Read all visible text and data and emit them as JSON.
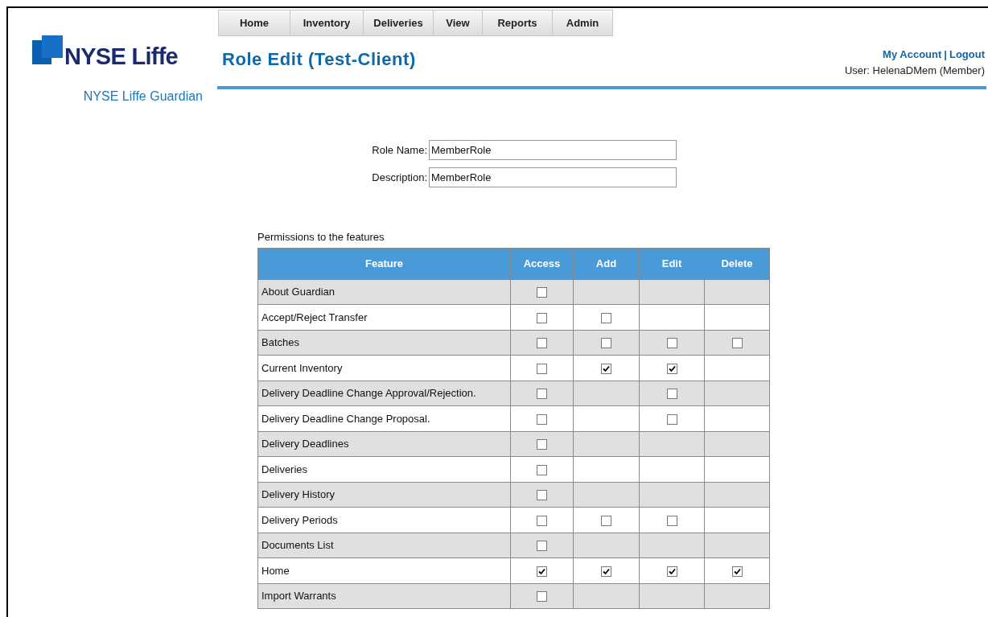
{
  "logo": {
    "text": "NYSE Liffe"
  },
  "nav": [
    {
      "label": "Home"
    },
    {
      "label": "Inventory"
    },
    {
      "label": "Deliveries"
    },
    {
      "label": "View"
    },
    {
      "label": "Reports"
    },
    {
      "label": "Admin"
    }
  ],
  "page_title": "Role Edit (Test-Client)",
  "account": {
    "my_account": "My Account",
    "separator": "|",
    "logout": "Logout",
    "user": "User: HelenaDMem (Member)"
  },
  "sidebar": {
    "link": "NYSE Liffe Guardian"
  },
  "form": [
    {
      "label": "Role Name:",
      "value": "MemberRole"
    },
    {
      "label": "Description:",
      "value": "MemberRole"
    }
  ],
  "permissions": {
    "caption": "Permissions to the features",
    "columns": [
      "Feature",
      "Access",
      "Add",
      "Edit",
      "Delete"
    ],
    "rows": [
      {
        "feature": "About Guardian",
        "access": false
      },
      {
        "feature": "Accept/Reject Transfer",
        "access": false,
        "add": false
      },
      {
        "feature": "Batches",
        "access": false,
        "add": false,
        "edit": false,
        "delete": false
      },
      {
        "feature": "Current Inventory",
        "access": false,
        "add": true,
        "edit": true
      },
      {
        "feature": "Delivery Deadline Change Approval/Rejection.",
        "access": false,
        "edit": false
      },
      {
        "feature": "Delivery Deadline Change Proposal.",
        "access": false,
        "edit": false
      },
      {
        "feature": "Delivery Deadlines",
        "access": false
      },
      {
        "feature": "Deliveries",
        "access": false
      },
      {
        "feature": "Delivery History",
        "access": false
      },
      {
        "feature": "Delivery Periods",
        "access": false,
        "add": false,
        "edit": false
      },
      {
        "feature": "Documents List",
        "access": false
      },
      {
        "feature": "Home",
        "access": true,
        "add": true,
        "edit": true,
        "delete": true
      },
      {
        "feature": "Import Warrants",
        "access": false
      }
    ]
  }
}
